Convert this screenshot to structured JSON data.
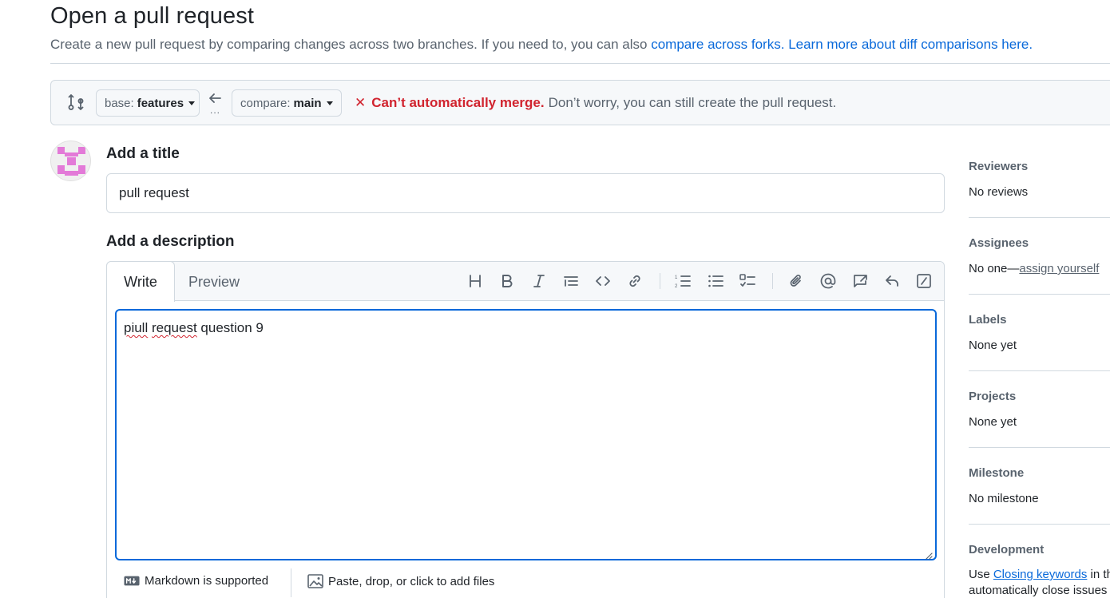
{
  "header": {
    "title": "Open a pull request",
    "subtitle_text": "Create a new pull request by comparing changes across two branches. If you need to, you can also ",
    "compare_forks_link": "compare across forks.",
    "learn_more_link": "Learn more about diff comparisons here."
  },
  "range": {
    "base_label": "base:",
    "base_branch": "features",
    "compare_label": "compare:",
    "compare_branch": "main",
    "ellipsis": "...",
    "merge_icon": "x-icon",
    "merge_error": "Can’t automatically merge.",
    "merge_message": "Don’t worry, you can still create the pull request."
  },
  "form": {
    "title_heading": "Add a title",
    "title_value": "pull request",
    "description_heading": "Add a description",
    "tabs": {
      "write": "Write",
      "preview": "Preview"
    },
    "description_misspelled_1": "piull",
    "description_misspelled_2": "request",
    "description_rest": " question 9",
    "markdown_note": "Markdown is supported",
    "files_note": "Paste, drop, or click to add files"
  },
  "toolbar": {
    "icons": [
      "heading-icon",
      "bold-icon",
      "italic-icon",
      "quote-icon",
      "code-icon",
      "link-icon",
      "ordered-list-icon",
      "unordered-list-icon",
      "task-list-icon",
      "attach-icon",
      "mention-icon",
      "reference-icon",
      "reply-icon",
      "slash-commands-icon"
    ]
  },
  "sidebar": {
    "reviewers_head": "Reviewers",
    "reviewers_val": "No reviews",
    "assignees_head": "Assignees",
    "assignees_val": "No one—",
    "assign_yourself": "assign yourself",
    "labels_head": "Labels",
    "labels_val": "None yet",
    "projects_head": "Projects",
    "projects_val": "None yet",
    "milestone_head": "Milestone",
    "milestone_val": "No milestone",
    "development_head": "Development",
    "development_prefix": "Use ",
    "closing_keywords": "Closing keywords",
    "development_suffix": " in th",
    "development_line2": "automatically close issues"
  },
  "colors": {
    "link": "#0969da",
    "danger": "#d1242f",
    "muted": "#59636e",
    "focus_border": "#0969da",
    "avatar_pink": "#e37ad8"
  }
}
